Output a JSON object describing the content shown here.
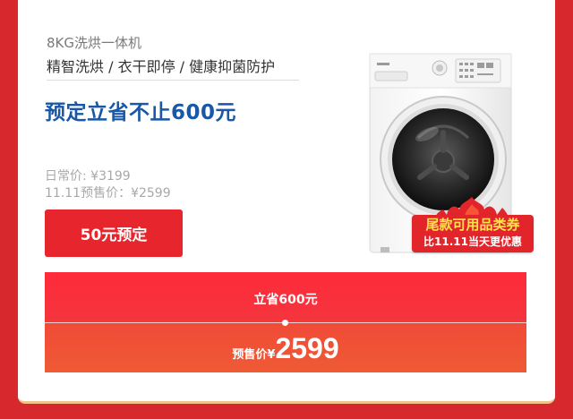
{
  "product": {
    "subtitle": "8KG洗烘一体机",
    "features": "精智洗烘 / 衣干即停 / 健康抑菌防护",
    "headline": "预定立省不止600元",
    "daily_price": "日常价: ¥3199",
    "presale_price_text": "11.11预售价：¥2599",
    "reserve_button": "50元预定"
  },
  "badge": {
    "line1": "尾款可用品类券",
    "line2": "比11.11当天更优惠"
  },
  "price_panel": {
    "savings": "立省600元",
    "presale_label": "预售价",
    "currency": "¥",
    "presale_value": "2599"
  },
  "colors": {
    "background": "#d7282d",
    "headline": "#1a57a6",
    "button": "#e6262c",
    "badge_highlight": "#ffe24a"
  },
  "icons": [
    "washing-machine-image",
    "flame-icon"
  ]
}
